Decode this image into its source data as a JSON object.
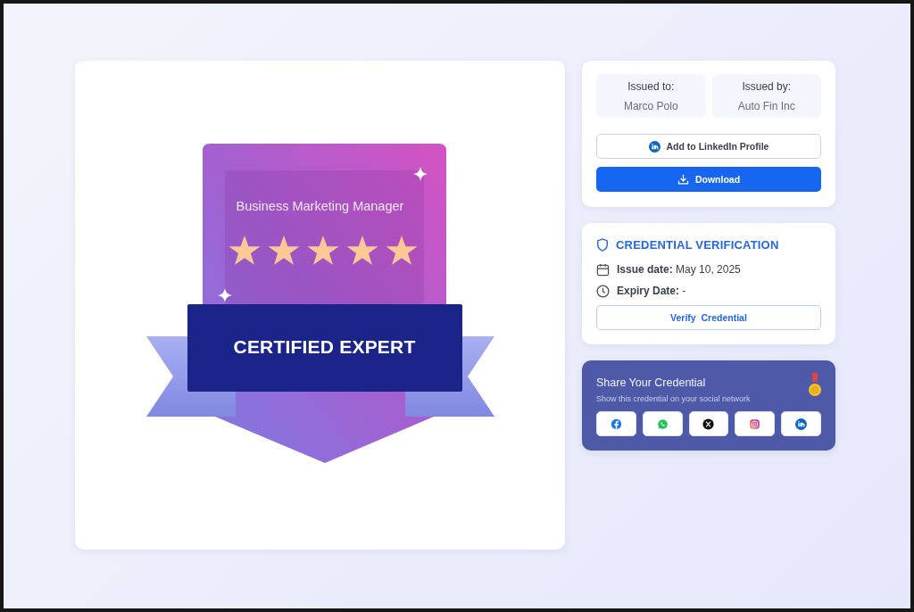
{
  "badge": {
    "title": "Business Marketing Manager",
    "stars": 5,
    "label": "CERTIFIED EXPERT"
  },
  "issued": [
    {
      "label": "Issued to:",
      "value": "Marco Polo"
    },
    {
      "label": "Issued by:",
      "value": "Auto Fin Inc"
    }
  ],
  "actions": [
    {
      "kind": "outline",
      "label": "Add to LinkedIn Profile"
    },
    {
      "kind": "primary",
      "label": "Download"
    }
  ],
  "verification": {
    "title": "CREDENTIAL VERIFICATION",
    "issue_date": "**Issue date:** May 10, 2025",
    "expiry_date": "**Expiry Date:** -",
    "button": "Verify  Credential"
  },
  "share": {
    "title": "Share Your Credential",
    "subtitle": "Show this credential on your social network"
  }
}
